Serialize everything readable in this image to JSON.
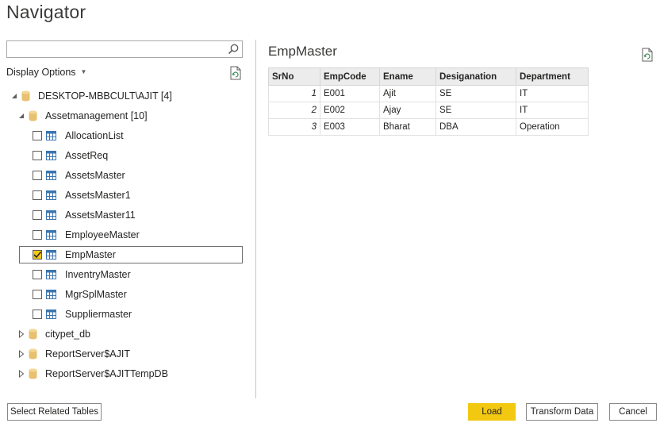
{
  "window": {
    "title": "Navigator"
  },
  "search": {
    "value": "",
    "placeholder": ""
  },
  "display_options": {
    "label": "Display Options"
  },
  "tree": {
    "server": {
      "label": "DESKTOP-MBBCULT\\AJIT [4]",
      "expanded": true
    },
    "database": {
      "label": "Assetmanagement [10]",
      "expanded": true
    },
    "tables": [
      {
        "label": "AllocationList",
        "checked": false
      },
      {
        "label": "AssetReq",
        "checked": false
      },
      {
        "label": "AssetsMaster",
        "checked": false
      },
      {
        "label": "AssetsMaster1",
        "checked": false
      },
      {
        "label": "AssetsMaster11",
        "checked": false
      },
      {
        "label": "EmployeeMaster",
        "checked": false
      },
      {
        "label": "EmpMaster",
        "checked": true
      },
      {
        "label": "InventryMaster",
        "checked": false
      },
      {
        "label": "MgrSplMaster",
        "checked": false
      },
      {
        "label": "Suppliermaster",
        "checked": false
      }
    ],
    "other_databases": [
      {
        "label": "citypet_db"
      },
      {
        "label": "ReportServer$AJIT"
      },
      {
        "label": "ReportServer$AJITTempDB"
      }
    ]
  },
  "preview": {
    "title": "EmpMaster",
    "columns": [
      "SrNo",
      "EmpCode",
      "Ename",
      "Desiganation",
      "Department"
    ],
    "rows": [
      [
        "1",
        "E001",
        "Ajit",
        "SE",
        "IT"
      ],
      [
        "2",
        "E002",
        "Ajay",
        "SE",
        "IT"
      ],
      [
        "3",
        "E003",
        "Bharat",
        "DBA",
        "Operation"
      ]
    ]
  },
  "buttons": {
    "select_related": "Select Related Tables",
    "load": "Load",
    "transform": "Transform Data",
    "cancel": "Cancel"
  },
  "colors": {
    "accent": "#f2c811",
    "database_icon": "#e8c170",
    "table_icon": "#3a75b0"
  }
}
